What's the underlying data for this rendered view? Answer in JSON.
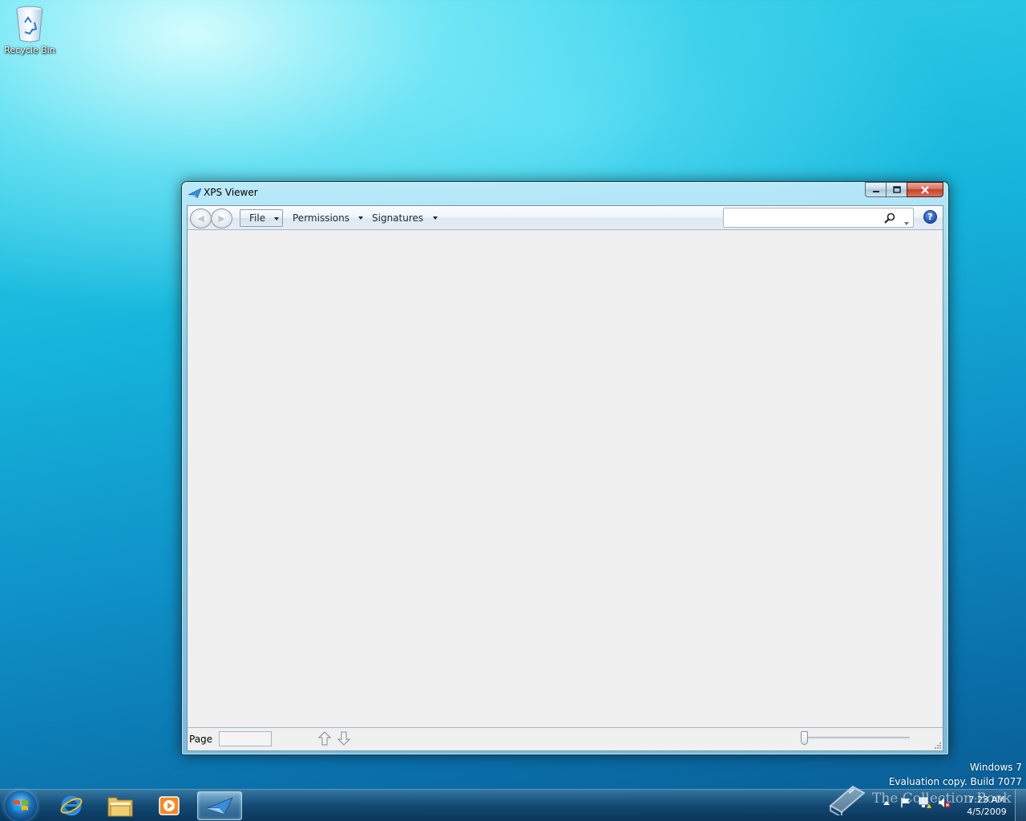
{
  "desktop": {
    "icons": [
      {
        "label": "Recycle Bin",
        "icon": "recycle-bin-icon"
      }
    ],
    "watermark": {
      "line1": "Windows 7",
      "line2": "Evaluation copy. Build 7077"
    }
  },
  "window": {
    "title": "XPS Viewer",
    "icon": "xps-viewer-icon",
    "menu": {
      "file_label": "File",
      "permissions_label": "Permissions",
      "signatures_label": "Signatures"
    },
    "search": {
      "value": "",
      "placeholder": ""
    },
    "statusbar": {
      "page_label": "Page",
      "page_value": ""
    },
    "zoom": {
      "level": 0
    }
  },
  "taskbar": {
    "pinned": [
      {
        "name": "internet-explorer",
        "icon": "internet-explorer-icon"
      },
      {
        "name": "windows-explorer",
        "icon": "folder-icon"
      },
      {
        "name": "windows-media-player",
        "icon": "media-player-icon"
      },
      {
        "name": "xps-viewer",
        "icon": "xps-viewer-icon",
        "active": true
      }
    ],
    "clock": {
      "time": "7:23 AM",
      "date": "4/5/2009"
    },
    "overlay_text": "The Collection Book"
  },
  "colors": {
    "desktop_top": "#3ed6ec",
    "desktop_bottom": "#0a5a90",
    "close_button": "#c4402a",
    "client_bg": "#f0f0f0"
  }
}
